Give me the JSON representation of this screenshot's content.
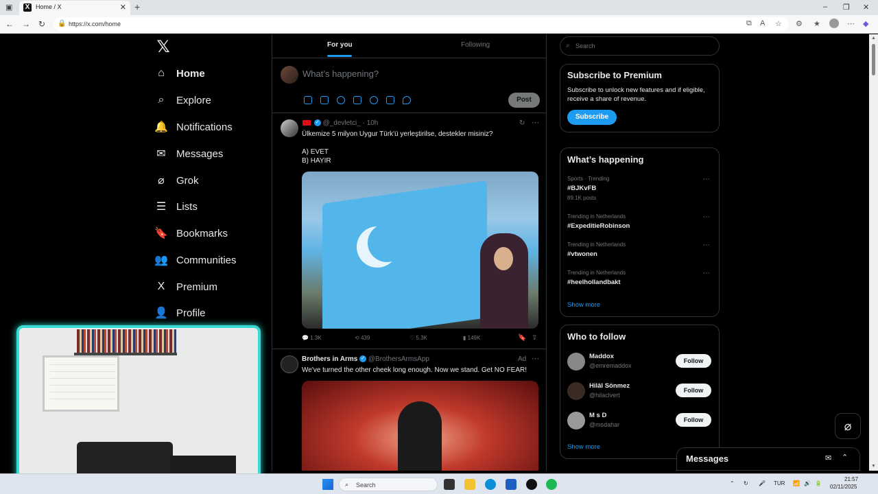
{
  "browser": {
    "tab_title": "Home / X",
    "tab_logo": "X",
    "url": "https://x.com/home"
  },
  "nav": {
    "items": [
      {
        "label": "Home",
        "icon": "home-icon",
        "glyph": "⌂"
      },
      {
        "label": "Explore",
        "icon": "search-icon",
        "glyph": "⌕"
      },
      {
        "label": "Notifications",
        "icon": "bell-icon",
        "glyph": "🔔"
      },
      {
        "label": "Messages",
        "icon": "envelope-icon",
        "glyph": "✉"
      },
      {
        "label": "Grok",
        "icon": "grok-icon",
        "glyph": "⌀"
      },
      {
        "label": "Lists",
        "icon": "list-icon",
        "glyph": "☰"
      },
      {
        "label": "Bookmarks",
        "icon": "bookmark-icon",
        "glyph": "🔖"
      },
      {
        "label": "Communities",
        "icon": "people-icon",
        "glyph": "👥"
      },
      {
        "label": "Premium",
        "icon": "x-icon",
        "glyph": "X"
      },
      {
        "label": "Profile",
        "icon": "person-icon",
        "glyph": "👤"
      }
    ]
  },
  "feed": {
    "tabs": [
      {
        "label": "For you"
      },
      {
        "label": "Following"
      }
    ],
    "compose_placeholder": "What’s happening?",
    "post_label": "Post",
    "tweets": [
      {
        "handle": "@_devletci_",
        "time": "· 10h",
        "lines": [
          "Ülkemize 5 milyon Uygur Türk'ü yerleştirilse, destekler misiniz?",
          "",
          "A) EVET",
          "B) HAYIR"
        ],
        "stats": {
          "replies": "1.3K",
          "reposts": "439",
          "likes": "5.3K",
          "views": "149K"
        }
      },
      {
        "name": "Brothers in Arms",
        "handle": "@BrothersArmsApp",
        "badge": "Ad",
        "lines": [
          "We've turned the other cheek long enough. Now we stand. Get NO FEAR!"
        ]
      }
    ]
  },
  "right": {
    "search_placeholder": "Search",
    "premium": {
      "title": "Subscribe to Premium",
      "text": "Subscribe to unlock new features and if eligible, receive a share of revenue.",
      "button": "Subscribe"
    },
    "happening": {
      "title": "What’s happening",
      "trends": [
        {
          "category": "Sports · Trending",
          "name": "#BJKvFB",
          "count": "89.1K posts"
        },
        {
          "category": "Trending in Netherlands",
          "name": "#ExpeditieRobinson",
          "count": ""
        },
        {
          "category": "Trending in Netherlands",
          "name": "#vtwonen",
          "count": ""
        },
        {
          "category": "Trending in Netherlands",
          "name": "#heelhollandbakt",
          "count": ""
        }
      ],
      "show_more": "Show more"
    },
    "who_to_follow": {
      "title": "Who to follow",
      "people": [
        {
          "name": "Maddox",
          "handle": "@emremaddox",
          "button": "Follow"
        },
        {
          "name": "Hilâl Sönmez",
          "handle": "@hilaclvert",
          "button": "Follow"
        },
        {
          "name": "M s D",
          "handle": "@msdahar",
          "button": "Follow"
        }
      ],
      "show_more": "Show more"
    },
    "messages_dock": "Messages"
  },
  "taskbar": {
    "search_placeholder": "Search",
    "language": "TUR",
    "time": "21:57",
    "date": "02/11/2025"
  }
}
